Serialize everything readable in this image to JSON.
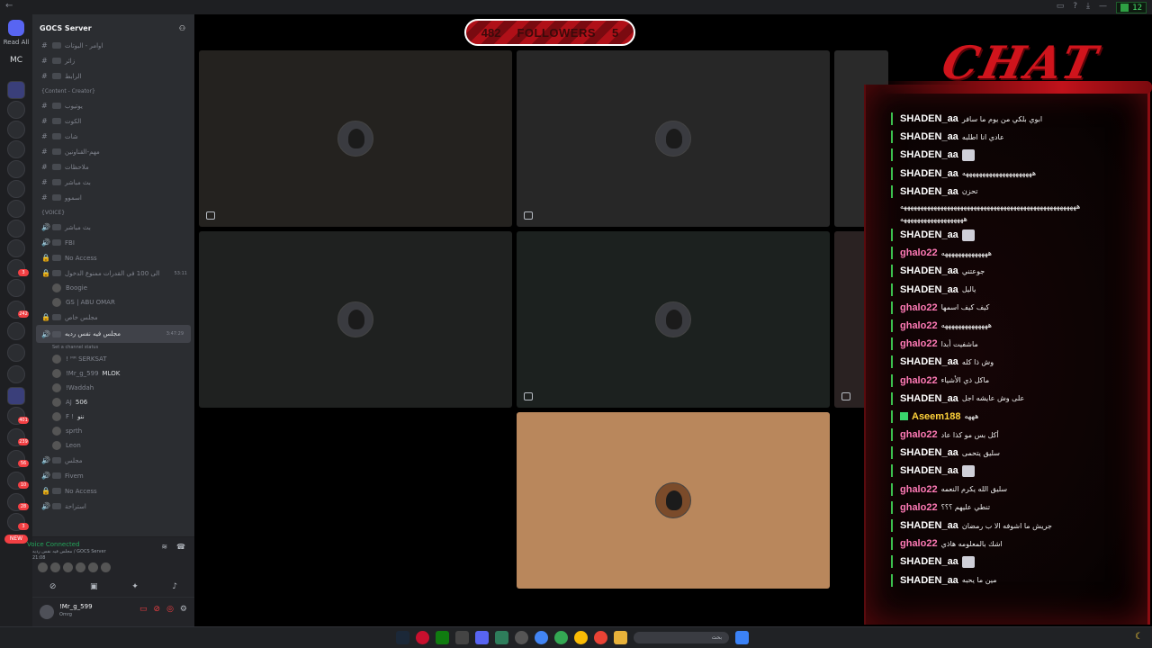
{
  "topbar": {
    "back_glyph": "←",
    "clock": "12"
  },
  "rail": {
    "read_all": "Read All",
    "mc_label": "MC",
    "badges": [
      "3",
      "242",
      "401",
      "239",
      "56",
      "10",
      "28",
      "3"
    ],
    "new_label": "NEW"
  },
  "guild": {
    "name": "GOCS Server",
    "chevron": "⌄"
  },
  "channels": [
    {
      "kind": "text",
      "label": "اوامر - البوتات"
    },
    {
      "kind": "text",
      "label": "زائر"
    },
    {
      "kind": "text",
      "label": "الرابط"
    },
    {
      "kind": "category",
      "label": "{Content - Creator}"
    },
    {
      "kind": "text",
      "label": "يوتيوب"
    },
    {
      "kind": "text",
      "label": "الكوت"
    },
    {
      "kind": "text",
      "label": "شات"
    },
    {
      "kind": "text",
      "label": "مهم-القناونين"
    },
    {
      "kind": "text",
      "label": "ملاحظات"
    },
    {
      "kind": "text",
      "label": "بث مباشر"
    },
    {
      "kind": "text",
      "label": "اسموو"
    },
    {
      "kind": "category",
      "label": "{VOICE}"
    },
    {
      "kind": "voice",
      "label": "بث مباشر"
    },
    {
      "kind": "voice",
      "label": "FBI"
    },
    {
      "kind": "locked",
      "label": "No Access"
    },
    {
      "kind": "locked",
      "label": "الى 100 في القدرات ممنوع الدخول",
      "time": "53:11"
    },
    {
      "kind": "member",
      "label": "Boogie"
    },
    {
      "kind": "member",
      "label": "GS | ABU OMAR"
    },
    {
      "kind": "locked",
      "label": "مجلس خاص"
    },
    {
      "kind": "active",
      "label": "مجلس فيه نفس رديه",
      "time": "3:47:29",
      "status": "Set a channel status"
    },
    {
      "kind": "member",
      "label": "! ᴹᴿ SERKSAT"
    },
    {
      "kind": "member",
      "label": "!Mr_g_599",
      "tag": "MLOK"
    },
    {
      "kind": "member",
      "label": "!Waddah"
    },
    {
      "kind": "member",
      "label": "AJ",
      "tag": "506"
    },
    {
      "kind": "member",
      "label": "F !",
      "tag": "ننو"
    },
    {
      "kind": "member",
      "label": "sprth"
    },
    {
      "kind": "member",
      "label": "Leon"
    },
    {
      "kind": "voice",
      "label": "مجلس"
    },
    {
      "kind": "voice",
      "label": "Fivem"
    },
    {
      "kind": "locked",
      "label": "No Access"
    },
    {
      "kind": "voice",
      "label": "استراحة"
    }
  ],
  "voice_panel": {
    "status": "Voice Connected",
    "channel": "مجلس فيه نفس رديه / GOCS Server",
    "time": "21:08"
  },
  "user": {
    "name": "!Mr_g_599",
    "status": "Omrg"
  },
  "followers": {
    "count": "482",
    "label": "FOLLOWERS",
    "goal": "5"
  },
  "chat": {
    "title": "CHAT",
    "messages": [
      {
        "user": "SHADEN_aa",
        "text": "ابوي بلكي من يوم ما سافر",
        "color": "white"
      },
      {
        "user": "SHADEN_aa",
        "text": "عادي انا اطلبه",
        "color": "white"
      },
      {
        "user": "SHADEN_aa",
        "text": "",
        "emote": true,
        "color": "white"
      },
      {
        "user": "SHADEN_aa",
        "text": "هههههههههههههههههههههه",
        "color": "white"
      },
      {
        "user": "SHADEN_aa",
        "text": "تحزن",
        "color": "white"
      },
      {
        "user": "",
        "text": "هههههههههههههههههههههههههههههههههههههههههههههههههههههه",
        "color": "white"
      },
      {
        "user": "",
        "text": "هههههههههههههههههههه",
        "color": "white"
      },
      {
        "user": "SHADEN_aa",
        "text": "",
        "emote": true,
        "color": "white"
      },
      {
        "user": "ghalo22",
        "text": "ههههههههههههههه",
        "color": "pink"
      },
      {
        "user": "SHADEN_aa",
        "text": "جوعتني",
        "color": "white"
      },
      {
        "user": "SHADEN_aa",
        "text": "ياليل",
        "color": "white"
      },
      {
        "user": "ghalo22",
        "text": "كيف كيف اسمها",
        "color": "pink"
      },
      {
        "user": "ghalo22",
        "text": "ههههههههههههههه",
        "color": "pink"
      },
      {
        "user": "ghalo22",
        "text": "ماشفيت أبدا",
        "color": "pink"
      },
      {
        "user": "SHADEN_aa",
        "text": "وش ذا كله",
        "color": "white"
      },
      {
        "user": "ghalo22",
        "text": "ماكل ذي الأشياء",
        "color": "pink"
      },
      {
        "user": "SHADEN_aa",
        "text": "على وش عايشه اجل",
        "color": "white"
      },
      {
        "user": "Aseem188",
        "text": "هههه",
        "color": "yellow",
        "twitch": true
      },
      {
        "user": "ghalo22",
        "text": "أكل بس مو كذا عاد",
        "color": "pink"
      },
      {
        "user": "SHADEN_aa",
        "text": "سليق يتحمى",
        "color": "white"
      },
      {
        "user": "SHADEN_aa",
        "text": "",
        "emote": true,
        "color": "white"
      },
      {
        "user": "ghalo22",
        "text": "سليق الله يكرم النعمه",
        "color": "pink"
      },
      {
        "user": "ghalo22",
        "text": "تنطي عليهم ؟؟؟",
        "color": "pink"
      },
      {
        "user": "SHADEN_aa",
        "text": "جريش ما اشوفه الا ب رمضان",
        "color": "white"
      },
      {
        "user": "ghalo22",
        "text": "اشك بالمعلومه هاذي",
        "color": "pink"
      },
      {
        "user": "SHADEN_aa",
        "text": "",
        "emote": true,
        "color": "white"
      },
      {
        "user": "SHADEN_aa",
        "text": "مين ما يحبه",
        "color": "white"
      }
    ]
  },
  "taskbar": {
    "search_placeholder": "بحث"
  },
  "colors": {
    "discord_bg": "#2b2d31",
    "chat_red": "#d0141c",
    "tile_bg": "#2b2d31",
    "speaking_tile": "#b9875c"
  }
}
